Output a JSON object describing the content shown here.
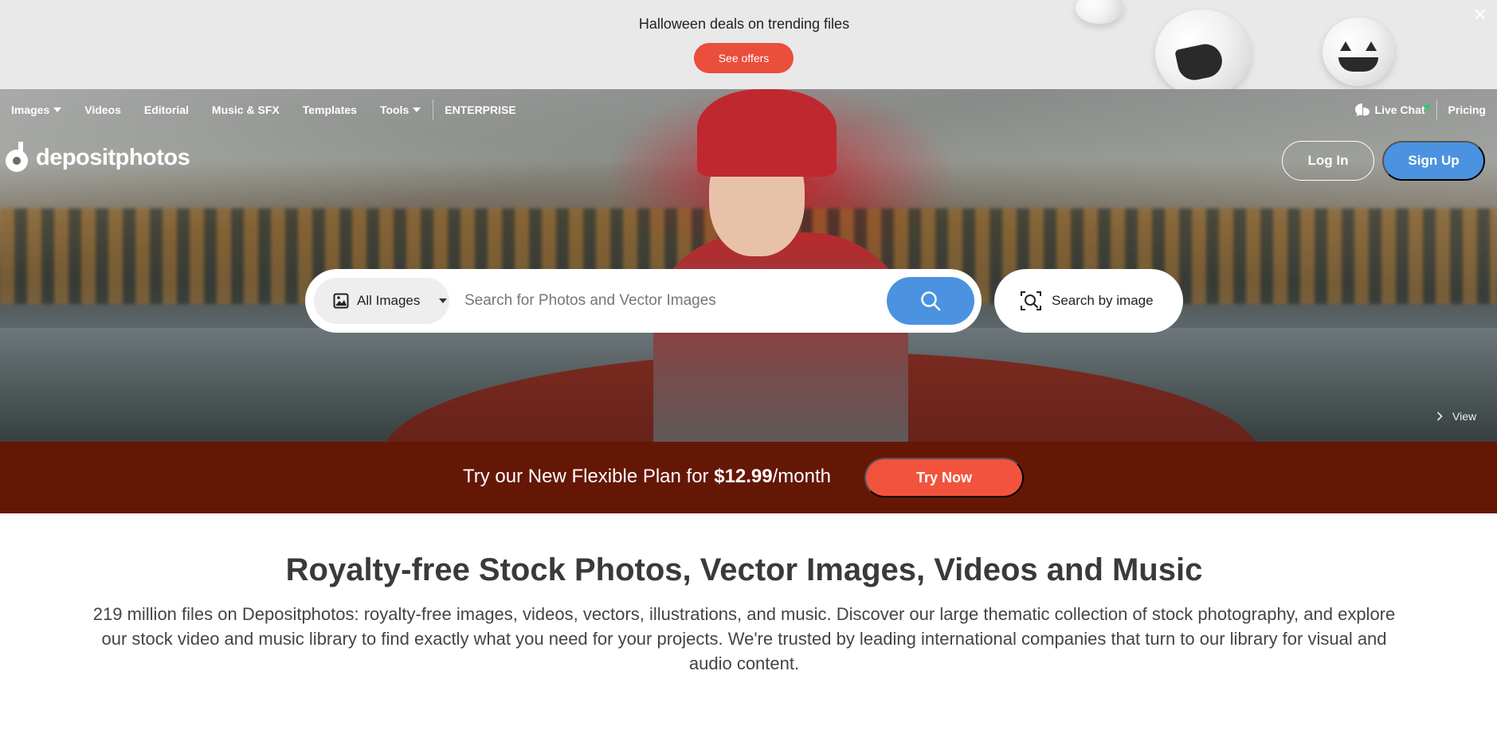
{
  "promo": {
    "title": "Halloween deals on trending files",
    "button": "See offers",
    "close": "✕"
  },
  "nav": {
    "items": [
      {
        "label": "Images",
        "dropdown": true
      },
      {
        "label": "Videos",
        "dropdown": false
      },
      {
        "label": "Editorial",
        "dropdown": false
      },
      {
        "label": "Music & SFX",
        "dropdown": false
      },
      {
        "label": "Templates",
        "dropdown": false
      },
      {
        "label": "Tools",
        "dropdown": true
      }
    ],
    "enterprise": "ENTERPRISE",
    "live_chat": "Live Chat",
    "pricing": "Pricing"
  },
  "logo": {
    "text": "depositphotos"
  },
  "auth": {
    "login": "Log In",
    "signup": "Sign Up"
  },
  "search": {
    "category": "All Images",
    "placeholder": "Search for Photos and Vector Images",
    "search_by_image": "Search by image"
  },
  "hero": {
    "view_link": "View"
  },
  "plan": {
    "text_before": "Try our New Flexible Plan for ",
    "price": "$12.99",
    "text_after": "/month",
    "button": "Try Now"
  },
  "intro": {
    "headline": "Royalty-free Stock Photos, Vector Images, Videos and Music",
    "body": "219 million files on Depositphotos: royalty-free images, videos, vectors, illustrations, and music. Discover our large thematic collection of stock photography, and explore our stock video and music library to find exactly what you need for your projects. We're trusted by leading international companies that turn to our library for visual and audio content."
  },
  "colors": {
    "accent_blue": "#4b93e0",
    "promo_red": "#ea4e3c",
    "plan_bg": "#651706",
    "try_now": "#f2533c",
    "live_dot": "#2ecc71"
  },
  "icons": {
    "caret": "caret-down-icon",
    "chat": "chat-bubble-icon",
    "image": "image-icon",
    "search": "search-icon",
    "camera_search": "image-search-icon",
    "chevron": "chevron-right-icon"
  }
}
